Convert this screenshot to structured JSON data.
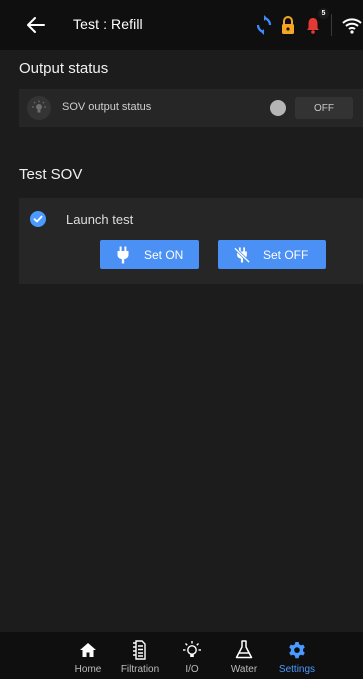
{
  "header": {
    "title": "Test : Refill",
    "back_icon": "back-arrow-icon",
    "bell_badge_count": "5",
    "icons": [
      "sync-icon",
      "lock-icon",
      "bell-icon",
      "wifi-icon"
    ],
    "colors": {
      "sync": "#3f8cff",
      "lock": "#f5a623",
      "bell": "#e53935"
    }
  },
  "output_status": {
    "section_title": "Output status",
    "item_label": "SOV output status",
    "state_label": "OFF",
    "icon": "bulb-icon"
  },
  "test_sov": {
    "section_title": "Test SOV",
    "launch_label": "Launch test",
    "launch_checked": true,
    "set_on_label": "Set ON",
    "set_off_label": "Set OFF",
    "accent": "#4a90f5"
  },
  "nav": {
    "items": [
      {
        "label": "Home",
        "icon": "home-icon"
      },
      {
        "label": "Filtration",
        "icon": "filtration-icon"
      },
      {
        "label": "I/O",
        "icon": "io-bulb-icon"
      },
      {
        "label": "Water",
        "icon": "water-flask-icon"
      },
      {
        "label": "Settings",
        "icon": "settings-gear-icon",
        "active": true
      }
    ]
  }
}
